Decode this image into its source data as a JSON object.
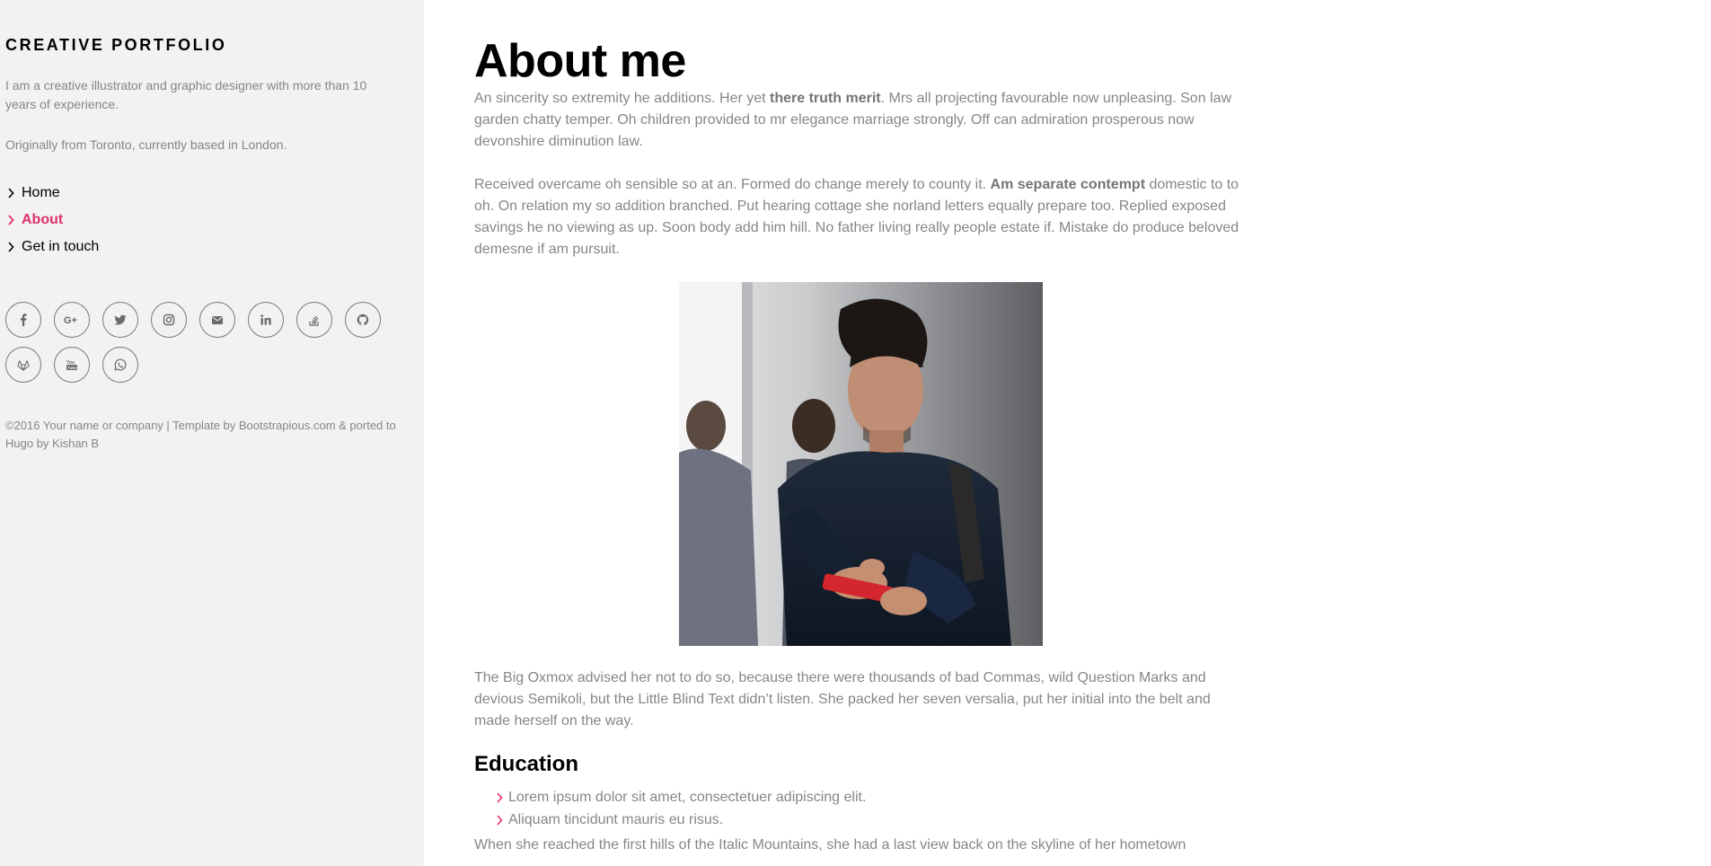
{
  "sidebar": {
    "brand": "CREATIVE PORTFOLIO",
    "intro": [
      "I am a creative illustrator and graphic designer with more than 10 years of experience.",
      "Originally from Toronto, currently based in London."
    ],
    "nav": [
      {
        "label": "Home",
        "active": false
      },
      {
        "label": "About",
        "active": true
      },
      {
        "label": "Get in touch",
        "active": false
      }
    ],
    "socials": [
      "facebook-icon",
      "google-plus-icon",
      "twitter-icon",
      "instagram-icon",
      "envelope-icon",
      "linkedin-icon",
      "stack-overflow-icon",
      "github-icon",
      "gitlab-icon",
      "youtube-icon",
      "whatsapp-icon"
    ],
    "footer": "©2016 Your name or company | Template by Bootstrapious.com & ported to Hugo by Kishan B"
  },
  "main": {
    "title": "About me",
    "para1": {
      "before": "An sincerity so extremity he additions. Her yet ",
      "bold": "there truth merit",
      "after": ". Mrs all projecting favourable now unpleasing. Son law garden chatty temper. Oh children provided to mr elegance marriage strongly. Off can admiration prosperous now devonshire diminution law."
    },
    "para2": {
      "before": "Received overcame oh sensible so at an. Formed do change merely to county it. ",
      "bold": "Am separate contempt",
      "after": " domestic to to oh. On relation my so addition branched. Put hearing cottage she norland letters equally prepare too. Replied exposed savings he no viewing as up. Soon body add him hill. No father living really people estate if. Mistake do produce beloved demesne if am pursuit."
    },
    "para3": "The Big Oxmox advised her not to do so, because there were thousands of bad Commas, wild Question Marks and devious Semikoli, but the Little Blind Text didn’t listen. She packed her seven versalia, put her initial into the belt and made herself on the way.",
    "education_title": "Education",
    "education": [
      "Lorem ipsum dolor sit amet, consectetuer adipiscing elit.",
      "Aliquam tincidunt mauris eu risus."
    ],
    "para4": "When she reached the first hills of the Italic Mountains, she had a last view back on the skyline of her hometown"
  },
  "colors": {
    "accent": "#e0306e",
    "sidebar_bg": "#f2f2f2",
    "text": "#868686",
    "heading": "#000000"
  }
}
